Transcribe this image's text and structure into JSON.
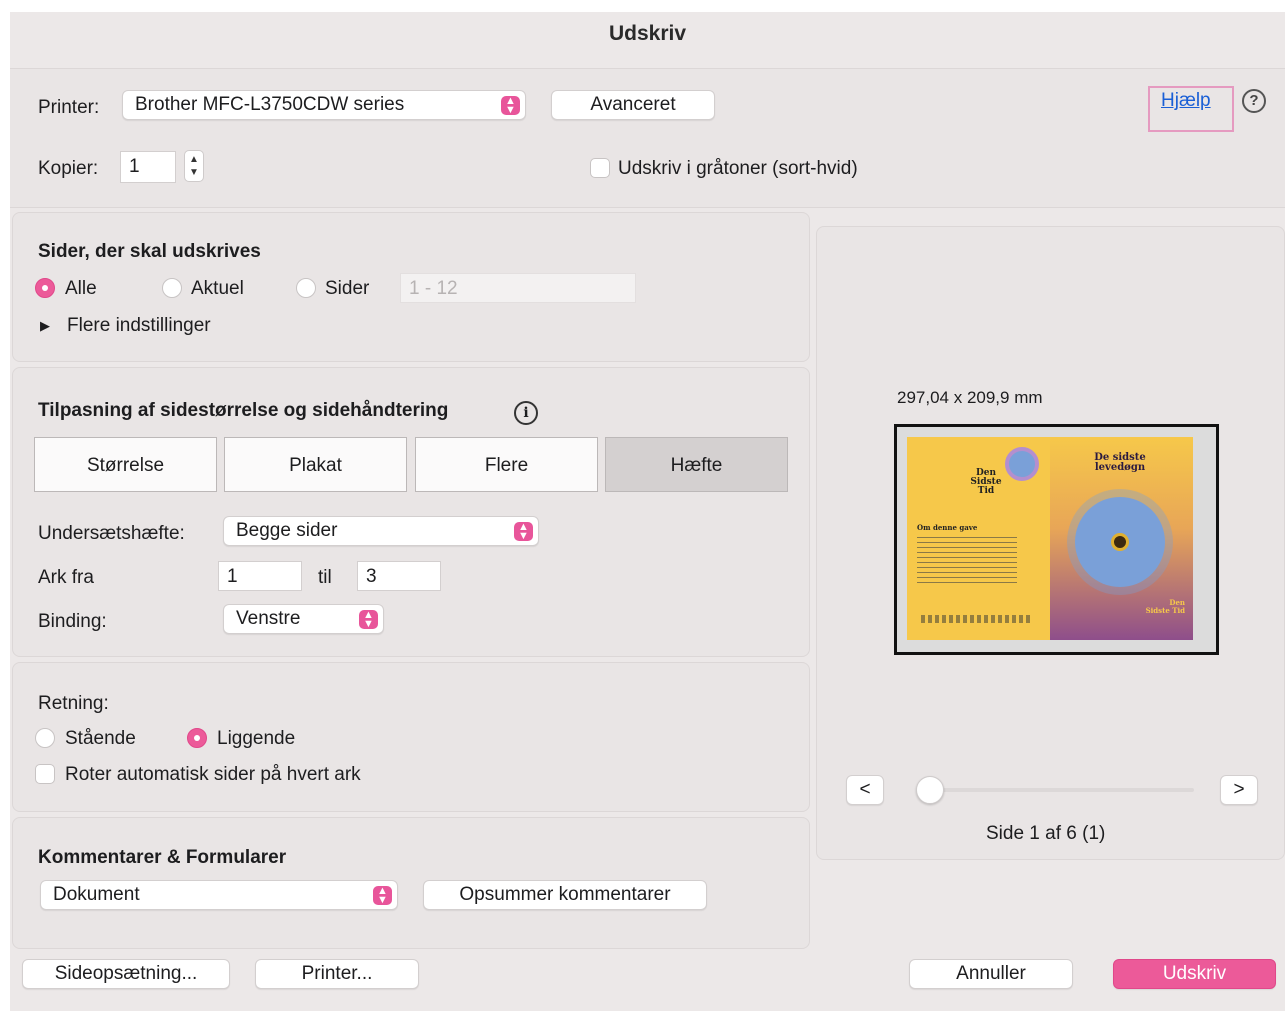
{
  "window": {
    "title": "Udskriv"
  },
  "printer": {
    "label": "Printer:",
    "selected": "Brother MFC-L3750CDW series",
    "advanced_button": "Avanceret",
    "help_link": "Hjælp",
    "help_icon": "question-circle-icon"
  },
  "copies": {
    "label": "Kopier:",
    "value": "1",
    "grayscale_label": "Udskriv i gråtoner (sort-hvid)",
    "grayscale_checked": false
  },
  "pages": {
    "heading": "Sider, der skal udskrives",
    "options": [
      "Alle",
      "Aktuel",
      "Sider"
    ],
    "selected": "Alle",
    "range_placeholder": "1 - 12",
    "more_settings": "Flere indstillinger"
  },
  "scaling": {
    "heading": "Tilpasning af sidestørrelse og sidehåndtering",
    "tabs": [
      "Størrelse",
      "Plakat",
      "Flere",
      "Hæfte"
    ],
    "active_tab": "Hæfte",
    "booklet_label": "Undersætshæfte:",
    "booklet_value": "Begge sider",
    "sheets_label": "Ark fra",
    "sheets_from": "1",
    "sheets_to_label": "til",
    "sheets_to": "3",
    "binding_label": "Binding:",
    "binding_value": "Venstre"
  },
  "orientation": {
    "heading": "Retning:",
    "options": [
      "Stående",
      "Liggende"
    ],
    "selected": "Liggende",
    "auto_rotate_label": "Roter automatisk sider på hvert ark",
    "auto_rotate_checked": false
  },
  "comments": {
    "heading": "Kommentarer & Formularer",
    "selected": "Dokument",
    "summarize_button": "Opsummer kommentarer"
  },
  "preview": {
    "size_label": "297,04 x 209,9 mm",
    "prev_button": "<",
    "next_button": ">",
    "page_indicator": "Side 1 af 6 (1)",
    "slider_position": 0,
    "left_page": {
      "title": "Den Sidste Tid",
      "section_heading": "Om denne gave"
    },
    "right_page": {
      "title": "De sidste levedøgn",
      "footer_title": "Den Sidste Tid"
    }
  },
  "footer": {
    "page_setup_button": "Sideopsætning...",
    "printer_button": "Printer...",
    "cancel_button": "Annuller",
    "print_button": "Udskriv"
  },
  "colors": {
    "accent": "#ec5a99",
    "link": "#1a5fd6",
    "highlight": "#e59ac0",
    "preview_yellow": "#f6c84a",
    "preview_purple": "#8e4e8b"
  }
}
